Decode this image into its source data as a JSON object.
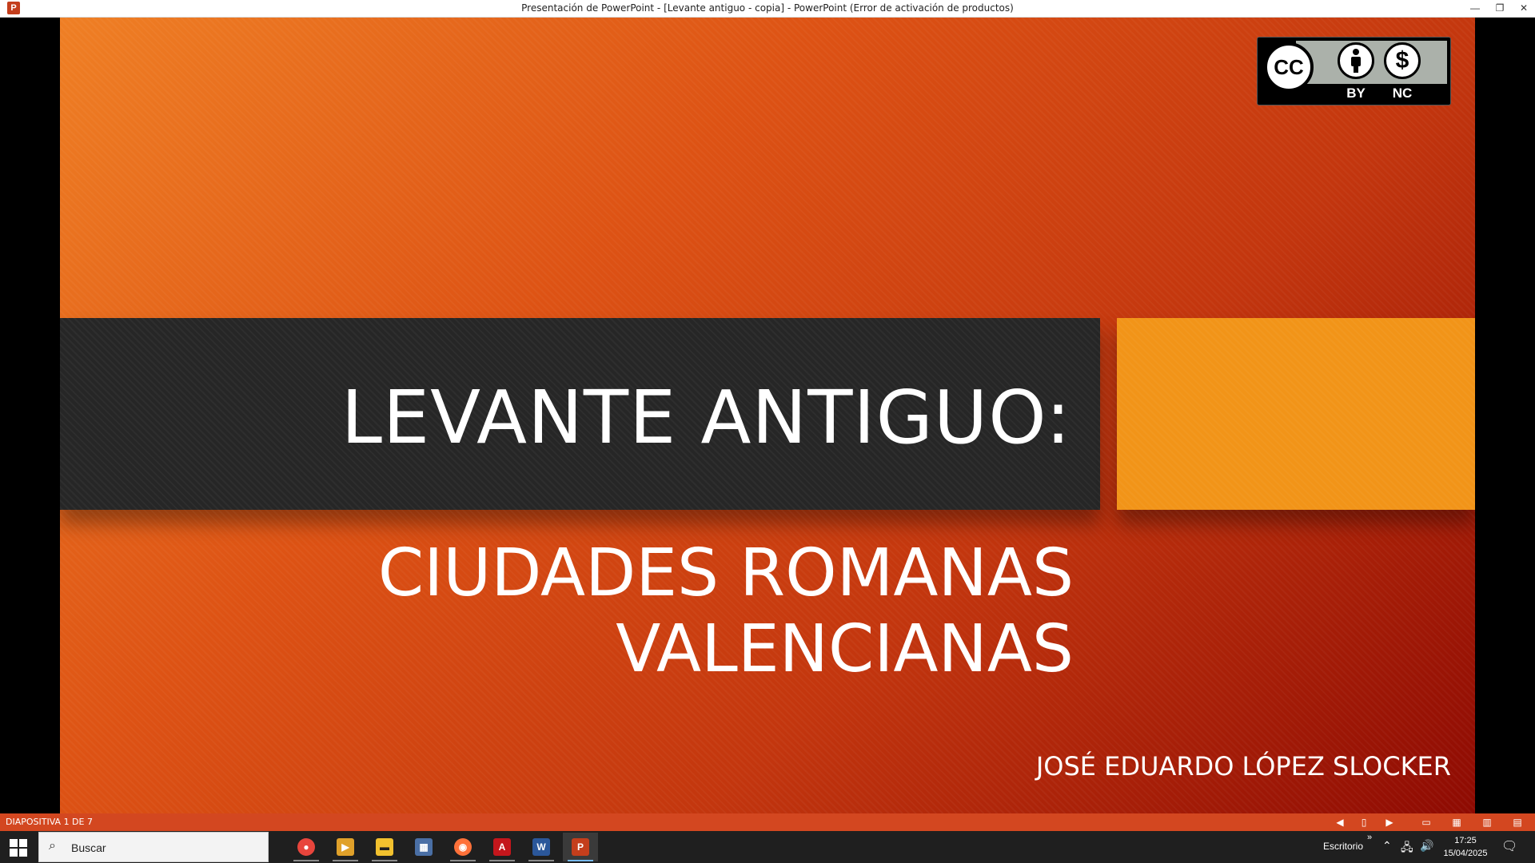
{
  "window": {
    "title": "Presentación de PowerPoint - [Levante antiguo - copia] - PowerPoint (Error de activación de productos)",
    "app_icon_letter": "P",
    "minimize_glyph": "—",
    "maximize_glyph": "❐",
    "close_glyph": "✕"
  },
  "slide": {
    "title": "LEVANTE ANTIGUO:",
    "subtitle_lines": [
      "CIUDADES ROMANAS",
      "VALENCIANAS"
    ],
    "author": "JOSÉ EDUARDO LÓPEZ SLOCKER",
    "license_badge": {
      "cc": "CC",
      "by": "BY",
      "nc": "NC",
      "nc_symbol": "$"
    },
    "colors": {
      "gradient_start": "#ef7f24",
      "gradient_end": "#8e0a02",
      "band": "#262626",
      "accent_block": "#f29418"
    }
  },
  "statusbar": {
    "slide_counter": "DIAPOSITIVA 1 DE 7",
    "color": "#d34720"
  },
  "taskbar": {
    "search_placeholder": "Buscar",
    "apps": [
      {
        "name": "chrome-icon",
        "glyph": "●",
        "color": "#e8453c"
      },
      {
        "name": "media-player-icon",
        "glyph": "▶",
        "color": "#e0a12a"
      },
      {
        "name": "file-explorer-icon",
        "glyph": "▬",
        "color": "#f2c12e"
      },
      {
        "name": "calculator-icon",
        "glyph": "▦",
        "color": "#4a6fa5"
      },
      {
        "name": "firefox-icon",
        "glyph": "◉",
        "color": "#ff7139"
      },
      {
        "name": "acrobat-icon",
        "glyph": "A",
        "color": "#c4161c"
      },
      {
        "name": "word-icon",
        "glyph": "W",
        "color": "#2b579a"
      },
      {
        "name": "powerpoint-icon",
        "glyph": "P",
        "color": "#c43e1c"
      }
    ],
    "tray": {
      "desktop_label": "Escritorio",
      "chevron": "»",
      "time": "17:25",
      "date": "15/04/2025"
    }
  }
}
